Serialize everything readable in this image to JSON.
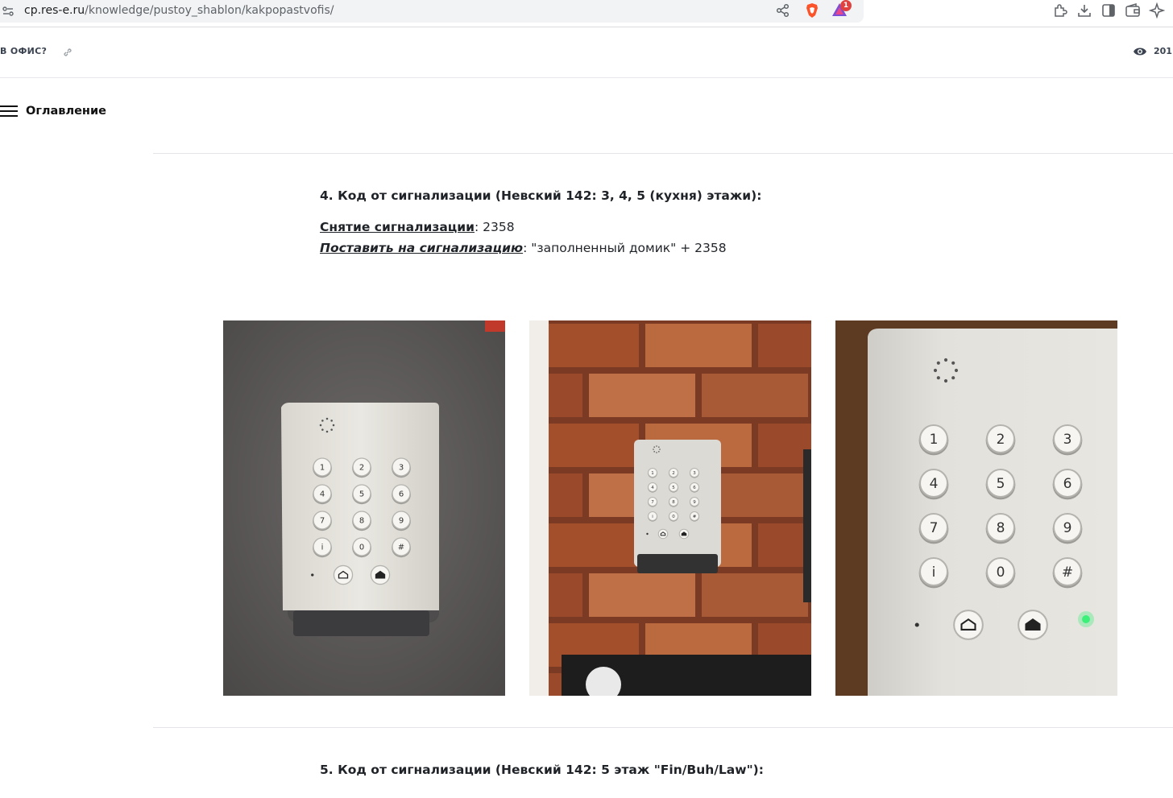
{
  "browser": {
    "url_host": "cp.res-e.ru",
    "url_path": "/knowledge/pustoy_shablon/kakpopastvofis/",
    "rewards_badge": "1",
    "icons": [
      "site-info-icon",
      "share-icon",
      "brave-shield-icon",
      "brave-rewards-icon",
      "extensions-icon",
      "downloads-icon",
      "sidebar-toggle-icon",
      "wallet-icon",
      "leo-ai-icon"
    ]
  },
  "page_header": {
    "crumb": "В ОФИС?",
    "views": "201"
  },
  "toc": {
    "label": "Оглавление"
  },
  "sections": {
    "s4": {
      "heading": "4. Код от сигнализации (Невский 142: 3, 4, 5 (кухня) этажи):",
      "disarm_label": "Снятие сигнализации",
      "disarm_value": ": 2358",
      "arm_label": "Поставить на сигнализацию",
      "arm_value": ": \"заполненный домик\" + 2358"
    },
    "s5": {
      "heading": "5. Код от сигнализации (Невский 142: 5 этаж \"Fin/Buh/Law\"):"
    }
  },
  "keypad": {
    "keys": [
      "1",
      "2",
      "3",
      "4",
      "5",
      "6",
      "7",
      "8",
      "9",
      "i",
      "0",
      "#"
    ]
  },
  "colors": {
    "text": "#1f2328",
    "keypad_body": "#e4e2dc",
    "brick": "#a5502f",
    "concrete": "#5b5857",
    "led_green": "#3df07a"
  }
}
